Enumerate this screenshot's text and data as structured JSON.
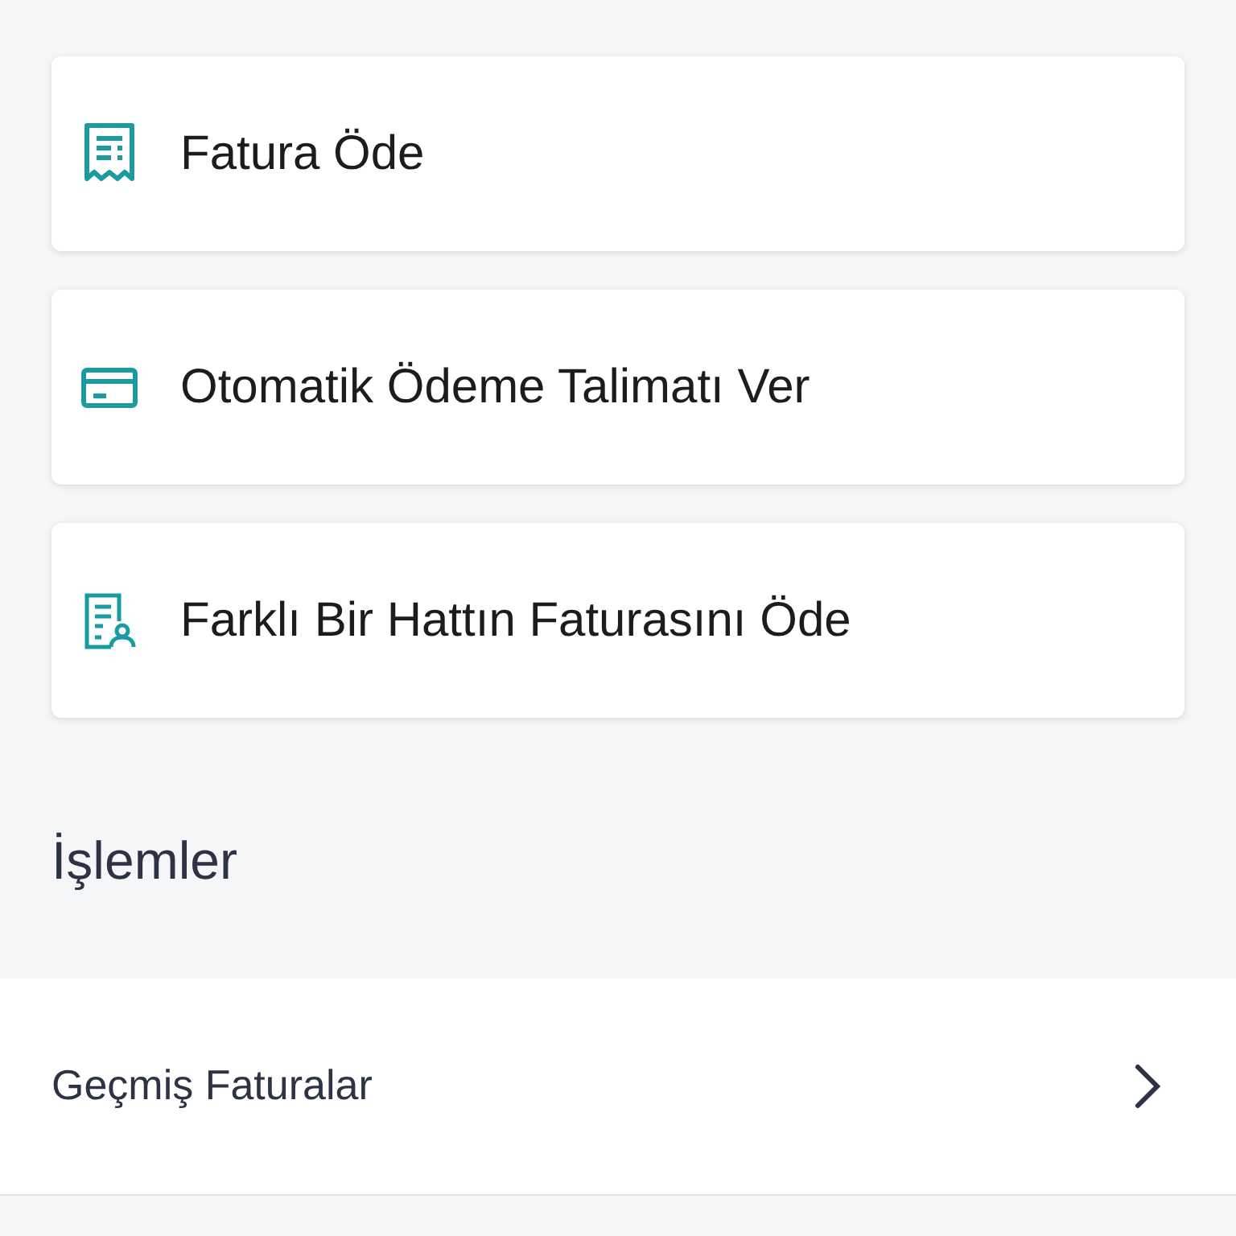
{
  "actions": [
    {
      "kind": "receipt",
      "label": "Fatura Öde"
    },
    {
      "kind": "card",
      "label": "Otomatik Ödeme Talimatı Ver"
    },
    {
      "kind": "person-doc",
      "label": "Farklı Bir Hattın Faturasını Öde"
    }
  ],
  "section_title": "İşlemler",
  "list_items": [
    {
      "label": "Geçmiş Faturalar"
    }
  ]
}
